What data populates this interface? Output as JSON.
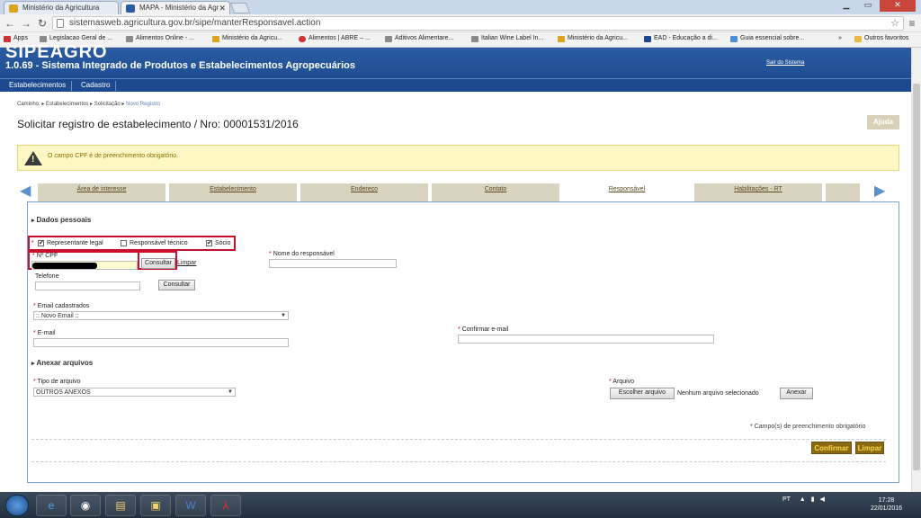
{
  "browser": {
    "tabs": [
      {
        "title": "Ministério da Agricultura"
      },
      {
        "title": "MAPA - Ministério da Agr"
      }
    ],
    "url": "sistemasweb.agricultura.gov.br/sipe/manterResponsavel.action",
    "bookmarks": [
      "Apps",
      "Legislacao Geral de ...",
      "Alimentos Online - ...",
      "Ministério da Agricu...",
      "Alimentos | ABRE – ...",
      "Aditivos Alimentare...",
      "Italian Wine Label In...",
      "Ministério da Agricu...",
      "EAD - Educação a di...",
      "Guia essencial sobre...",
      "Outros favoritos"
    ],
    "bookmarks_overflow": "»"
  },
  "site": {
    "logo": "SIPEAGRO",
    "system_name": "1.0.69 - Sistema Integrado de Produtos e Estabelecimentos Agropecuários",
    "logout": "Sair do Sistema",
    "menu": [
      "Estabelecimentos",
      "Cadastro"
    ]
  },
  "page": {
    "breadcrumb": {
      "prefix": "Caminho: ▸ Estabelecimentos ▸ Solicitação ▸",
      "current": "Novo Registro"
    },
    "title": "Solicitar registro de estabelecimento / Nro: 00001531/2016",
    "help_button": "Ajuda",
    "alert": "O campo CPF é de preenchimento obrigatório.",
    "wizard_tabs": [
      "Área de interesse",
      "Estabelecimento",
      "Endereço",
      "Contato",
      "Responsável",
      "Habilitações - RT",
      ""
    ],
    "active_tab": "Responsável"
  },
  "form": {
    "section_personal": "Dados pessoais",
    "roles": [
      {
        "label": "Representante legal",
        "checked": true,
        "mark": "✔"
      },
      {
        "label": "Responsável técnico",
        "checked": false,
        "mark": ""
      },
      {
        "label": "Sócio",
        "checked": true,
        "mark": "✔"
      }
    ],
    "cpf_label": "Nº CPF",
    "consult_button": "Consultar",
    "clear_link": "Limpar",
    "responsible_name_label": "Nome do responsável",
    "phone_label": "Telefone",
    "phone_consult_button": "Consultar",
    "email_registered_label": "Email cadastrados",
    "email_registered_value": ":: Novo Email ::",
    "email_label": "E-mail",
    "confirm_email_label": "Confirmar e-mail",
    "section_attachments": "Anexar arquivos",
    "file_type_label": "Tipo de arquivo",
    "file_type_value": "OUTROS ANEXOS",
    "file_label": "Arquivo",
    "choose_file_button": "Escolher arquivo",
    "no_file_text": "Nenhum arquivo selecionado",
    "attach_button": "Anexar",
    "required_note": "* Campo(s) de preenchimento obrigatório",
    "confirm_button": "Confirmar",
    "clear_button": "Limpar",
    "required_marker": "*"
  },
  "taskbar": {
    "tray_lang": "PT",
    "time": "17:28",
    "date": "22/01/2016"
  }
}
